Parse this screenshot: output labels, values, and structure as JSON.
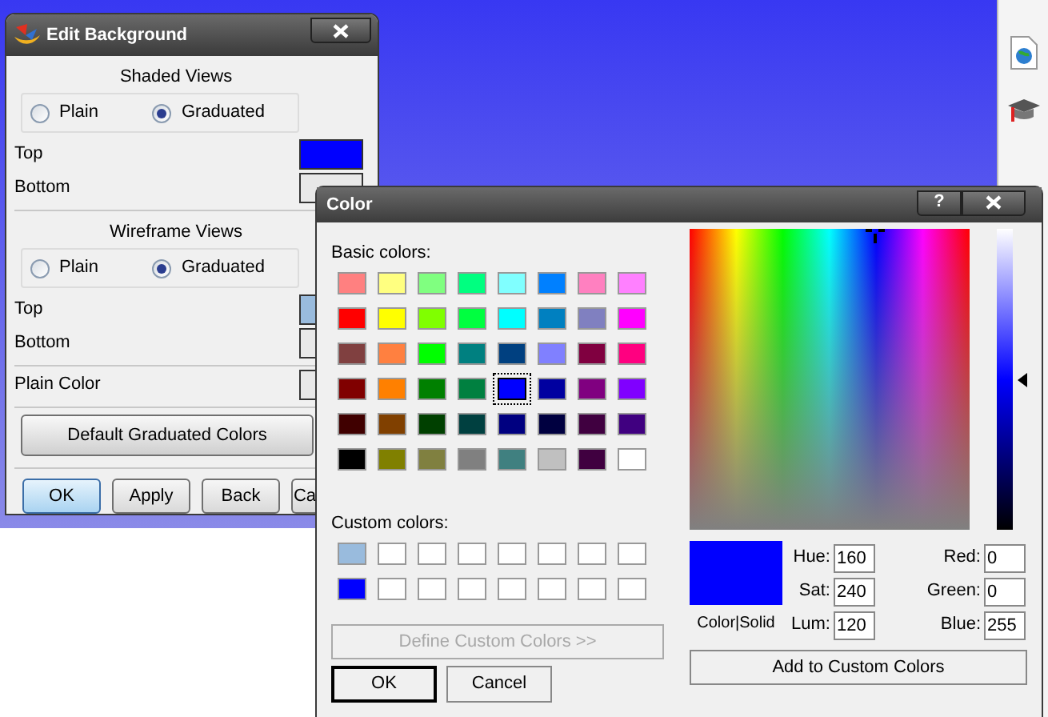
{
  "edit_background": {
    "title": "Edit Background",
    "sections": [
      {
        "heading": "Shaded Views",
        "options": [
          {
            "label": "Plain",
            "selected": false
          },
          {
            "label": "Graduated",
            "selected": true
          }
        ],
        "rows": [
          {
            "label": "Top",
            "color": "#0000ff"
          },
          {
            "label": "Bottom",
            "color": "#e8e8e8"
          }
        ]
      },
      {
        "heading": "Wireframe Views",
        "options": [
          {
            "label": "Plain",
            "selected": false
          },
          {
            "label": "Graduated",
            "selected": true
          }
        ],
        "rows": [
          {
            "label": "Top",
            "color": "#99bbdd"
          },
          {
            "label": "Bottom",
            "color": "#e8e8e8"
          },
          {
            "label": "Plain Color",
            "color": "#e8e8e8"
          }
        ]
      }
    ],
    "default_button": "Default Graduated Colors",
    "buttons": [
      {
        "label": "OK",
        "selected": true
      },
      {
        "label": "Apply",
        "selected": false
      },
      {
        "label": "Back",
        "selected": false
      },
      {
        "label": "Ca",
        "selected": false
      }
    ]
  },
  "color_dialog": {
    "title": "Color",
    "help": "?",
    "basic_label": "Basic colors:",
    "basic_colors": [
      {
        "color": "#ff8080",
        "selected": false
      },
      {
        "color": "#ffff80",
        "selected": false
      },
      {
        "color": "#80ff80",
        "selected": false
      },
      {
        "color": "#00ff80",
        "selected": false
      },
      {
        "color": "#80ffff",
        "selected": false
      },
      {
        "color": "#0080ff",
        "selected": false
      },
      {
        "color": "#ff80c0",
        "selected": false
      },
      {
        "color": "#ff80ff",
        "selected": false
      },
      {
        "color": "#ff0000",
        "selected": false
      },
      {
        "color": "#ffff00",
        "selected": false
      },
      {
        "color": "#80ff00",
        "selected": false
      },
      {
        "color": "#00ff40",
        "selected": false
      },
      {
        "color": "#00ffff",
        "selected": false
      },
      {
        "color": "#0080c0",
        "selected": false
      },
      {
        "color": "#8080c0",
        "selected": false
      },
      {
        "color": "#ff00ff",
        "selected": false
      },
      {
        "color": "#804040",
        "selected": false
      },
      {
        "color": "#ff8040",
        "selected": false
      },
      {
        "color": "#00ff00",
        "selected": false
      },
      {
        "color": "#008080",
        "selected": false
      },
      {
        "color": "#004080",
        "selected": false
      },
      {
        "color": "#8080ff",
        "selected": false
      },
      {
        "color": "#800040",
        "selected": false
      },
      {
        "color": "#ff0080",
        "selected": false
      },
      {
        "color": "#800000",
        "selected": false
      },
      {
        "color": "#ff8000",
        "selected": false
      },
      {
        "color": "#008000",
        "selected": false
      },
      {
        "color": "#008040",
        "selected": false
      },
      {
        "color": "#0000ff",
        "selected": true
      },
      {
        "color": "#0000a0",
        "selected": false
      },
      {
        "color": "#800080",
        "selected": false
      },
      {
        "color": "#8000ff",
        "selected": false
      },
      {
        "color": "#400000",
        "selected": false
      },
      {
        "color": "#804000",
        "selected": false
      },
      {
        "color": "#004000",
        "selected": false
      },
      {
        "color": "#004040",
        "selected": false
      },
      {
        "color": "#000080",
        "selected": false
      },
      {
        "color": "#000040",
        "selected": false
      },
      {
        "color": "#400040",
        "selected": false
      },
      {
        "color": "#400080",
        "selected": false
      },
      {
        "color": "#000000",
        "selected": false
      },
      {
        "color": "#808000",
        "selected": false
      },
      {
        "color": "#808040",
        "selected": false
      },
      {
        "color": "#808080",
        "selected": false
      },
      {
        "color": "#408080",
        "selected": false
      },
      {
        "color": "#c0c0c0",
        "selected": false
      },
      {
        "color": "#400040",
        "selected": false
      },
      {
        "color": "#ffffff",
        "selected": false
      }
    ],
    "custom_label": "Custom colors:",
    "custom_colors": [
      {
        "color": "#99bbdd"
      },
      {
        "color": "#ffffff"
      },
      {
        "color": "#ffffff"
      },
      {
        "color": "#ffffff"
      },
      {
        "color": "#ffffff"
      },
      {
        "color": "#ffffff"
      },
      {
        "color": "#ffffff"
      },
      {
        "color": "#ffffff"
      },
      {
        "color": "#0000ff"
      },
      {
        "color": "#ffffff"
      },
      {
        "color": "#ffffff"
      },
      {
        "color": "#ffffff"
      },
      {
        "color": "#ffffff"
      },
      {
        "color": "#ffffff"
      },
      {
        "color": "#ffffff"
      },
      {
        "color": "#ffffff"
      }
    ],
    "define_button": {
      "label": "Define Custom Colors >>",
      "disabled": true
    },
    "ok": "OK",
    "cancel": "Cancel",
    "luminance": {
      "level": 0.5
    },
    "preview": {
      "color": "#0000ff",
      "label": "Color|Solid"
    },
    "fields_left": [
      {
        "label": "Hue:",
        "value": "160"
      },
      {
        "label": "Sat:",
        "value": "240"
      },
      {
        "label": "Lum:",
        "value": "120"
      }
    ],
    "fields_right": [
      {
        "label": "Red:",
        "value": "0"
      },
      {
        "label": "Green:",
        "value": "0"
      },
      {
        "label": "Blue:",
        "value": "255"
      }
    ],
    "add_button": "Add to Custom Colors"
  }
}
